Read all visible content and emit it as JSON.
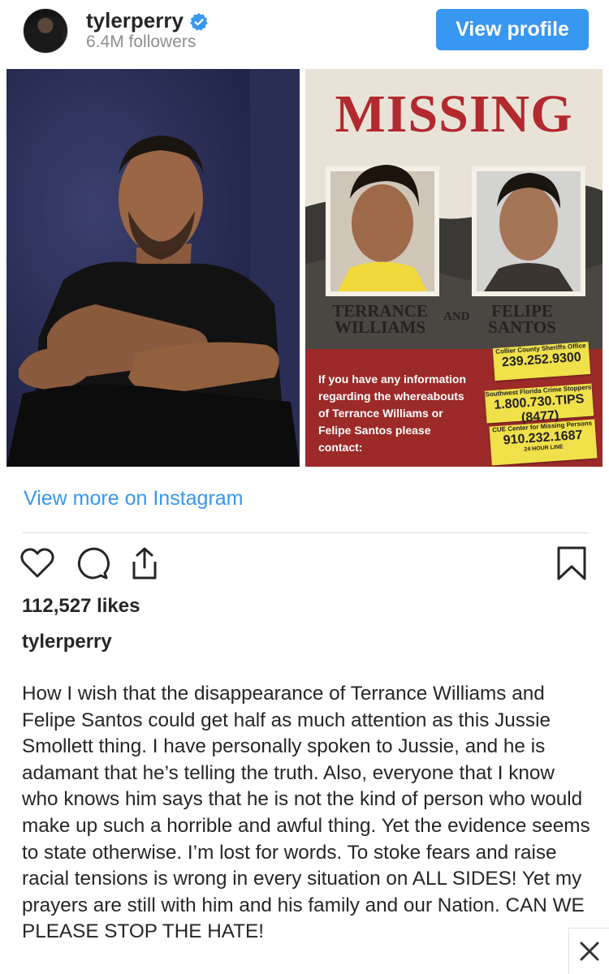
{
  "header": {
    "username": "tylerperry",
    "followers": "6.4M followers",
    "view_profile_label": "View profile"
  },
  "poster": {
    "title": "MISSING",
    "person1_first": "TERRANCE",
    "person1_last": "WILLIAMS",
    "and_label": "AND",
    "person2_first": "FELIPE",
    "person2_last": "SANTOS",
    "info_text": "If you have any information regarding the whereabouts of Terrance Williams or Felipe Santos please contact:",
    "contacts": [
      {
        "org": "Collier County Sheriffs Office",
        "number": "239.252.9300",
        "sub": ""
      },
      {
        "org": "Southwest Florida Crime Stoppers",
        "number": "1.800.730.TIPS (8477)",
        "sub": ""
      },
      {
        "org": "CUE Center for Missing Persons",
        "number": "910.232.1687",
        "sub": "24 HOUR LINE"
      }
    ]
  },
  "view_more_label": "View more on Instagram",
  "likes": "112,527 likes",
  "caption": {
    "username": "tylerperry",
    "text": "How I wish that the disappearance of Terrance Williams and Felipe Santos could get half as much attention as this Jussie Smollett thing. I have personally spoken to Jussie, and he is adamant that he’s telling the truth. Also, everyone that I know who knows him says that he is not the kind of person who would make up such a horrible and awful thing. Yet the evidence seems to state otherwise. I’m lost for words. To stoke fears and raise racial tensions is wrong in every situation on ALL SIDES! Yet my prayers are still with him and his family and our Nation. CAN WE PLEASE STOP THE HATE!"
  },
  "colors": {
    "accent": "#3897f0",
    "poster_red": "#b2292e",
    "tag_yellow": "#f0e04a"
  }
}
